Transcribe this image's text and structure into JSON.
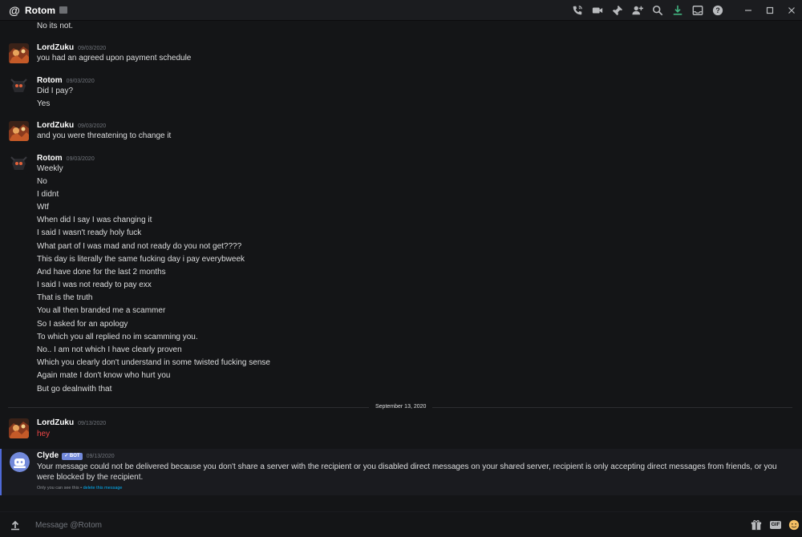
{
  "titlebar": {
    "channel_name": "Rotom",
    "at_symbol": "@"
  },
  "toolbar": {
    "icons": [
      "phone-call-icon",
      "video-call-icon",
      "pin-icon",
      "add-friend-icon",
      "search-icon",
      "download-icon",
      "inbox-icon",
      "help-icon"
    ],
    "help_glyph": "?"
  },
  "window_controls": [
    "minimize-icon",
    "maximize-icon",
    "close-icon"
  ],
  "messages": {
    "intro_line": "No its not.",
    "groups": [
      {
        "author": "LordZuku",
        "timestamp": "09/03/2020",
        "lines": [
          "you had an agreed upon payment schedule"
        ]
      },
      {
        "author": "Rotom",
        "timestamp": "09/03/2020",
        "lines": [
          "Did I pay?",
          "Yes"
        ]
      },
      {
        "author": "LordZuku",
        "timestamp": "09/03/2020",
        "lines": [
          "and you were threatening to change it"
        ]
      },
      {
        "author": "Rotom",
        "timestamp": "09/03/2020",
        "lines": [
          "Weekly",
          "No",
          "I didnt",
          "Wtf",
          "When did I say I was changing it",
          "I said I wasn't ready holy fuck",
          "What part of I was mad and not ready do you not get????",
          "This day is literally the same fucking day i pay everybweek",
          "And have done for the last 2 months",
          "I said I was not ready to pay exx",
          "That is the truth",
          "You all then branded me a scammer",
          "So I asked for an apology",
          "To which you all replied no im scamming you.",
          "No.. I am not which I have clearly proven",
          "Which you clearly don't understand in some twisted fucking sense",
          "Again mate I don't know who hurt you",
          "But go dealnwith that"
        ]
      }
    ],
    "date_divider": "September 13, 2020",
    "after_divider": [
      {
        "author": "LordZuku",
        "timestamp": "09/13/2020",
        "lines": [
          "hey"
        ]
      }
    ],
    "system": {
      "author": "Clyde",
      "badge": "✓ BOT",
      "timestamp": "09/13/2020",
      "text": "Your message could not be delivered because you don't share a server with the recipient or you disabled direct messages on your shared server, recipient is only accepting direct messages from friends, or you were blocked by the recipient.",
      "ephemeral_note": "Only you can see this •",
      "delete_link": "delete this message"
    }
  },
  "composer": {
    "placeholder": "Message @Rotom",
    "gif_label": "GIF"
  },
  "colors": {
    "background": "#141517",
    "titlebar": "#1b1c1f",
    "text": "#dcddde",
    "muted": "#72767d",
    "accent_bot": "#7289da",
    "link": "#00aff4",
    "danger": "#f04747",
    "download_green": "#43b581"
  }
}
